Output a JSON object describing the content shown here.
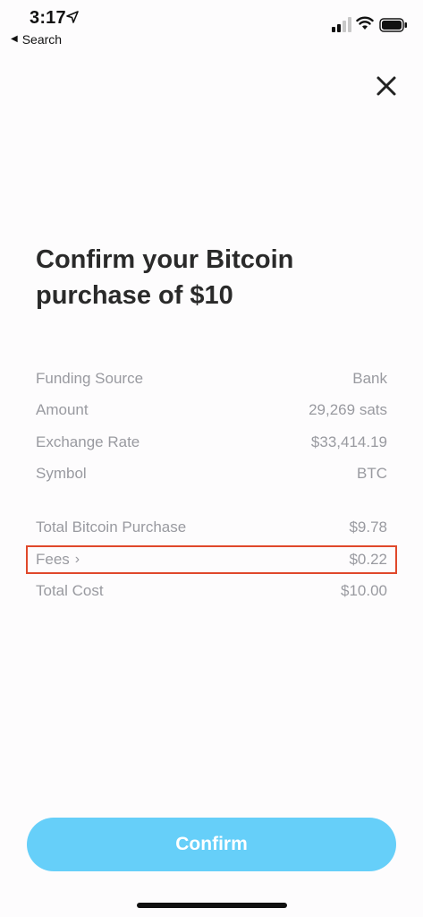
{
  "status_bar": {
    "time": "3:17",
    "back_label": "Search"
  },
  "header": {
    "close_icon": "close-icon"
  },
  "title": "Confirm your Bitcoin purchase of $10",
  "details": [
    {
      "label": "Funding Source",
      "value": "Bank"
    },
    {
      "label": "Amount",
      "value": "29,269 sats"
    },
    {
      "label": "Exchange Rate",
      "value": "$33,414.19"
    },
    {
      "label": "Symbol",
      "value": "BTC"
    }
  ],
  "summary": {
    "total_bitcoin_purchase_label": "Total Bitcoin Purchase",
    "total_bitcoin_purchase_value": "$9.78",
    "fees_label": "Fees",
    "fees_value": "$0.22",
    "total_cost_label": "Total Cost",
    "total_cost_value": "$10.00"
  },
  "confirm_label": "Confirm",
  "colors": {
    "confirm_bg": "#66cff9",
    "highlight_border": "#e0482b",
    "muted_text": "#999aa0",
    "title_text": "#2a2a2a"
  }
}
